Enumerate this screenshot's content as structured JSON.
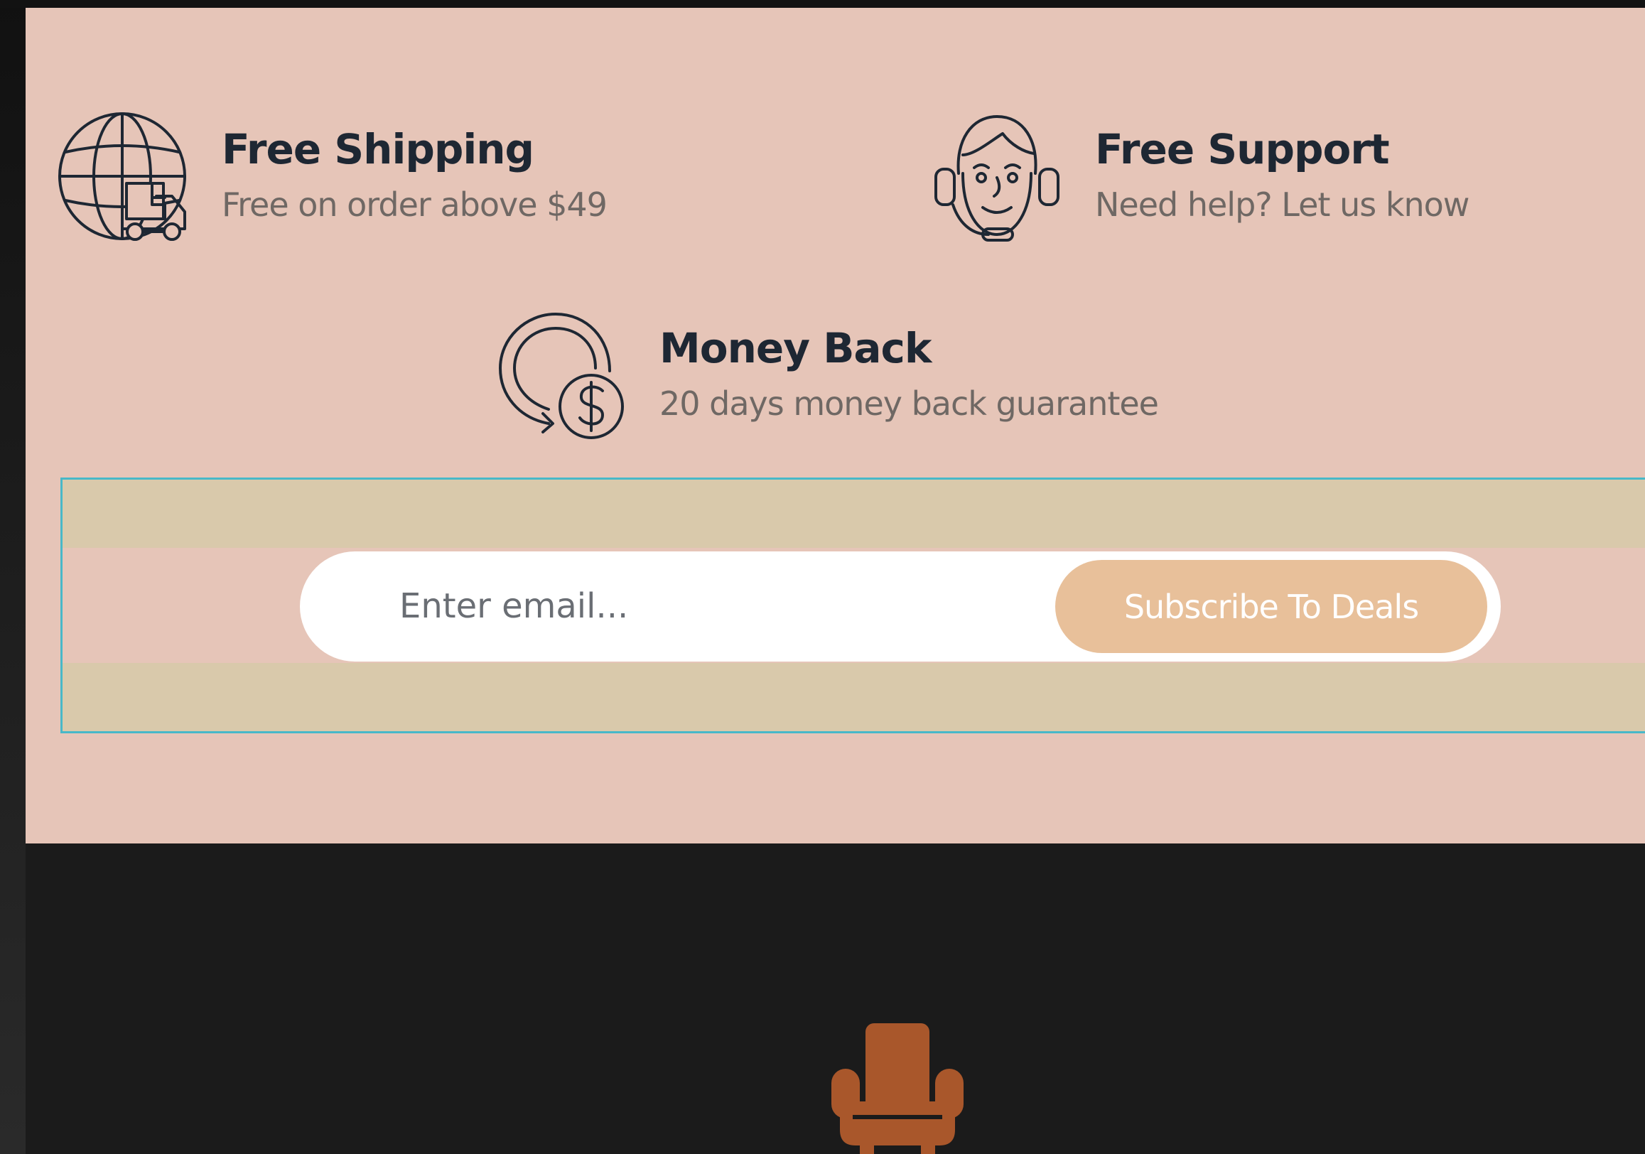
{
  "features": {
    "shipping": {
      "title": "Free Shipping",
      "description": "Free on order above $49",
      "icon": "globe-truck-icon"
    },
    "support": {
      "title": "Free Support",
      "description": "Need help? Let us know",
      "icon": "headset-agent-icon"
    },
    "money_back": {
      "title": "Money Back",
      "description": "20 days money back guarantee",
      "icon": "money-back-icon"
    }
  },
  "newsletter": {
    "email_placeholder": "Enter email...",
    "email_value": "",
    "subscribe_label": "Subscribe To Deals"
  },
  "footer": {
    "logo_icon": "armchair-icon"
  },
  "colors": {
    "section_background": "#e6c5b8",
    "newsletter_background": "#d9c9ab",
    "button_background": "#e8c09a",
    "footer_background": "#1b1b1b",
    "logo_color": "#a9572b",
    "title_text": "#1e2733",
    "selection_outline": "#48b8c8"
  }
}
